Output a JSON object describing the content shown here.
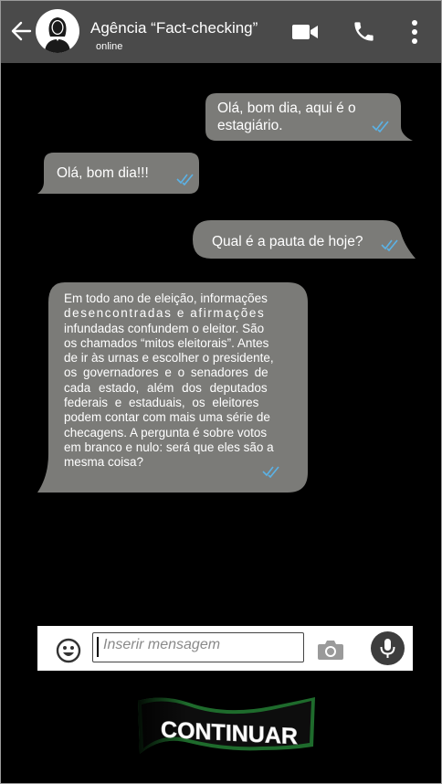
{
  "header": {
    "contact_name": "Agência “Fact-checking”",
    "status": "online",
    "icons": [
      "back-arrow-icon",
      "avatar",
      "video-call-icon",
      "phone-icon",
      "more-options-icon"
    ],
    "background_color": "#4a4a4a"
  },
  "messages": [
    {
      "direction": "outgoing",
      "lines": [
        "Olá, bom dia, aqui é o",
        "estagiário."
      ],
      "read": true
    },
    {
      "direction": "incoming",
      "lines": [
        "Olá, bom dia!!!"
      ],
      "read": true
    },
    {
      "direction": "outgoing",
      "lines": [
        "Qual é a pauta de hoje?"
      ],
      "read": true
    },
    {
      "direction": "incoming",
      "lines": [
        "Em todo ano de eleição, informações",
        "desencontradas e afirmações",
        "infundadas confundem o eleitor. São",
        "os chamados “mitos eleitorais”. Antes",
        "de ir às urnas e escolher o presidente,",
        "os governadores e o senadores de",
        "cada estado, além dos deputados",
        "federais e estaduais, os eleitores",
        "podem contar com mais uma série de",
        "checagens. A pergunta é sobre votos",
        "em branco e nulo: será que eles são a",
        "mesma coisa?"
      ],
      "read": true
    }
  ],
  "composer": {
    "placeholder": "Inserir mensagem",
    "icons": [
      "emoji-icon",
      "camera-icon",
      "microphone-icon"
    ]
  },
  "continue_button": {
    "label": "CONTINUAR"
  },
  "colors": {
    "bubble": "#7b7b78",
    "tick": "#5bb2e6",
    "chat_background": "#000000",
    "banner_green": "#1e6b2c"
  }
}
